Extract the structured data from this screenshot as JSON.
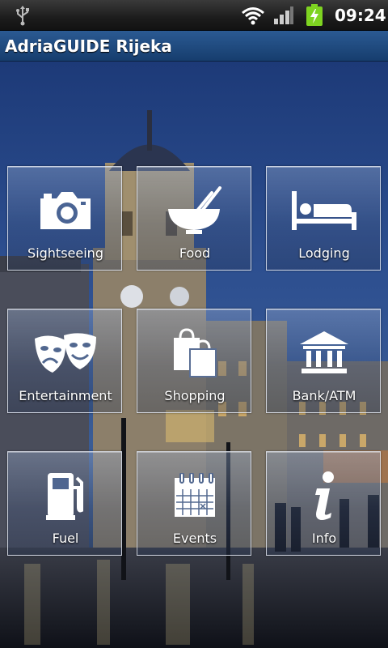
{
  "status_bar": {
    "time": "09:24",
    "icons": [
      "usb-icon",
      "wifi-icon",
      "signal-icon",
      "battery-charging-icon"
    ]
  },
  "app": {
    "title": "AdriaGUIDE Rijeka"
  },
  "menu": {
    "tiles": [
      {
        "label": "Sightseeing",
        "icon": "camera-icon"
      },
      {
        "label": "Food",
        "icon": "bowl-chopsticks-icon"
      },
      {
        "label": "Lodging",
        "icon": "bed-icon"
      },
      {
        "label": "Entertainment",
        "icon": "theater-masks-icon"
      },
      {
        "label": "Shopping",
        "icon": "shopping-bags-icon"
      },
      {
        "label": "Bank/ATM",
        "icon": "bank-icon"
      },
      {
        "label": "Fuel",
        "icon": "fuel-pump-icon"
      },
      {
        "label": "Events",
        "icon": "calendar-icon"
      },
      {
        "label": "Info",
        "icon": "info-icon"
      }
    ]
  },
  "colors": {
    "title_bar": "#1f4a80",
    "sky": "#2f4f8f",
    "tile_border": "#e6ebf5",
    "battery": "#7ed321"
  }
}
